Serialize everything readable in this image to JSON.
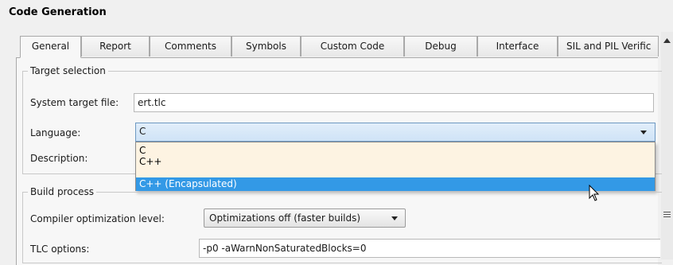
{
  "section_title": "Code Generation",
  "tabs": [
    {
      "label": "General",
      "active": true
    },
    {
      "label": "Report",
      "active": false
    },
    {
      "label": "Comments",
      "active": false
    },
    {
      "label": "Symbols",
      "active": false
    },
    {
      "label": "Custom Code",
      "active": false
    },
    {
      "label": "Debug",
      "active": false
    },
    {
      "label": "Interface",
      "active": false
    },
    {
      "label": "SIL and PIL Verific",
      "active": false
    }
  ],
  "target_selection": {
    "legend": "Target selection",
    "system_target_file_label": "System target file:",
    "system_target_file_value": "ert.tlc",
    "language_label": "Language:",
    "language_value": "C",
    "description_label": "Description:",
    "language_options": [
      "C",
      "C++",
      "C++ (Encapsulated)"
    ],
    "highlighted_option_index": 2
  },
  "build_process": {
    "legend": "Build process",
    "compiler_opt_label": "Compiler optimization level:",
    "compiler_opt_value": "Optimizations off (faster builds)",
    "tlc_options_label": "TLC options:",
    "tlc_options_value": "-p0 -aWarnNonSaturatedBlocks=0"
  },
  "colors": {
    "dropdown_bg": "#fdf3e2",
    "highlight": "#3399e6",
    "selected_combo": "#cfe3f7"
  },
  "icons": [
    "scroll-up-icon",
    "dropdown-arrow-icon",
    "mouse-cursor-icon",
    "scroll-grip-icon"
  ]
}
